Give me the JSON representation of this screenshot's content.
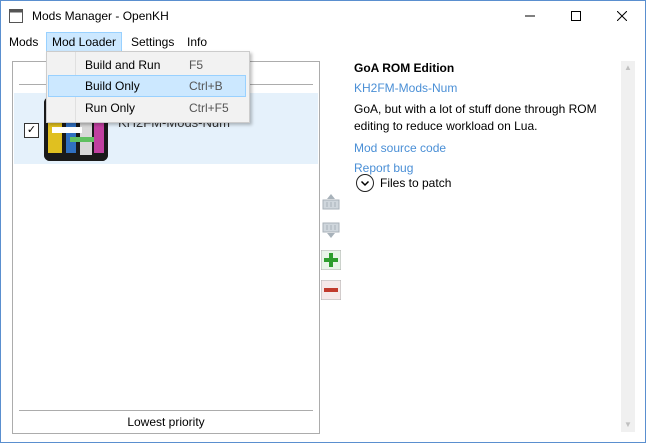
{
  "window": {
    "title": "Mods Manager - OpenKH"
  },
  "menubar": {
    "items": [
      "Mods",
      "Mod Loader",
      "Settings",
      "Info"
    ]
  },
  "dropdown": {
    "items": [
      {
        "label": "Build and Run",
        "shortcut": "F5"
      },
      {
        "label": "Build Only",
        "shortcut": "Ctrl+B"
      },
      {
        "label": "Run Only",
        "shortcut": "Ctrl+F5"
      }
    ]
  },
  "mod_list": {
    "items": [
      {
        "title": "KH2FM-Mods-Num",
        "checked": true
      }
    ],
    "footer": "Lowest priority"
  },
  "details": {
    "title": "GoA ROM Edition",
    "author_link": "KH2FM-Mods-Num",
    "description": "GoA, but with a lot of stuff done through ROM editing to reduce workload on Lua.",
    "source_link": "Mod source code",
    "bug_link": "Report bug",
    "files_label": "Files to patch"
  },
  "colors": {
    "accent": "#4a8fd6",
    "add": "#2e9e2e",
    "remove": "#c0392b",
    "selected": "#cce8ff"
  }
}
